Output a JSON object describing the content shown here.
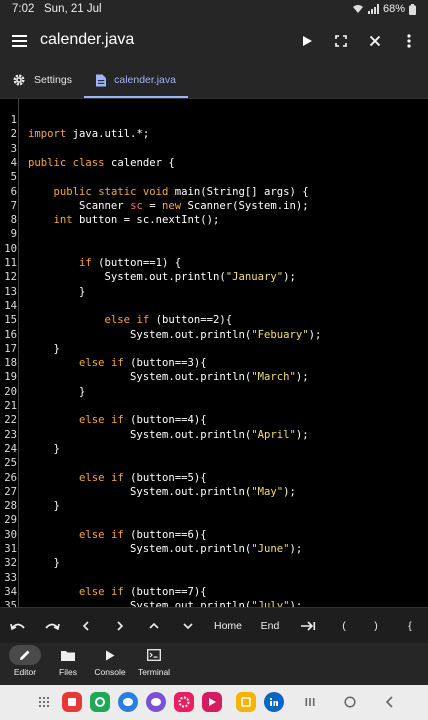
{
  "status": {
    "time": "7:02",
    "date": "Sun, 21 Jul",
    "battery": "68%"
  },
  "appbar": {
    "title": "calender.java"
  },
  "tabs": [
    {
      "label": "Settings"
    },
    {
      "label": "calender.java"
    }
  ],
  "code": [
    {
      "n": "1",
      "t": ""
    },
    {
      "n": "2",
      "t": "import java.util.*;"
    },
    {
      "n": "3",
      "t": ""
    },
    {
      "n": "4",
      "t": "public class calender {"
    },
    {
      "n": "5",
      "t": ""
    },
    {
      "n": "6",
      "t": "    public static void main(String[] args) {"
    },
    {
      "n": "7",
      "t": "        Scanner sc = new Scanner(System.in);"
    },
    {
      "n": "8",
      "t": "    int button = sc.nextInt();"
    },
    {
      "n": "9",
      "t": ""
    },
    {
      "n": "10",
      "t": ""
    },
    {
      "n": "11",
      "t": "        if (button==1) {"
    },
    {
      "n": "12",
      "t": "            System.out.println(\"January\");"
    },
    {
      "n": "13",
      "t": "        }"
    },
    {
      "n": "14",
      "t": ""
    },
    {
      "n": "15",
      "t": "            else if (button==2){"
    },
    {
      "n": "16",
      "t": "                System.out.println(\"Febuary\");"
    },
    {
      "n": "17",
      "t": "    }"
    },
    {
      "n": "18",
      "t": "        else if (button==3){"
    },
    {
      "n": "19",
      "t": "                System.out.println(\"March\");"
    },
    {
      "n": "20",
      "t": "        }"
    },
    {
      "n": "21",
      "t": ""
    },
    {
      "n": "22",
      "t": "        else if (button==4){"
    },
    {
      "n": "23",
      "t": "                System.out.println(\"April\");"
    },
    {
      "n": "24",
      "t": "    }"
    },
    {
      "n": "25",
      "t": ""
    },
    {
      "n": "26",
      "t": "        else if (button==5){"
    },
    {
      "n": "27",
      "t": "                System.out.println(\"May\");"
    },
    {
      "n": "28",
      "t": "    }"
    },
    {
      "n": "29",
      "t": ""
    },
    {
      "n": "30",
      "t": "        else if (button==6){"
    },
    {
      "n": "31",
      "t": "                System.out.println(\"June\");"
    },
    {
      "n": "32",
      "t": "    }"
    },
    {
      "n": "33",
      "t": ""
    },
    {
      "n": "34",
      "t": "        else if (button==7){"
    },
    {
      "n": "35",
      "t": "                System.out.println(\"July\");"
    }
  ],
  "keys": {
    "home": "Home",
    "end": "End",
    "lparen": "(",
    "rparen": ")",
    "lbrace": "{"
  },
  "nav": [
    {
      "label": "Editor"
    },
    {
      "label": "Files"
    },
    {
      "label": "Console"
    },
    {
      "label": "Terminal"
    }
  ],
  "icons": {
    "menu": "hamburger-icon",
    "run": "play-icon",
    "fullscreen": "fullscreen-icon",
    "close": "close-icon",
    "more": "more-vertical-icon"
  },
  "colors": {
    "keyword": "#f4a838",
    "string": "#f5de74",
    "variable": "#ff6b6b",
    "accent": "#9fb4ff"
  }
}
